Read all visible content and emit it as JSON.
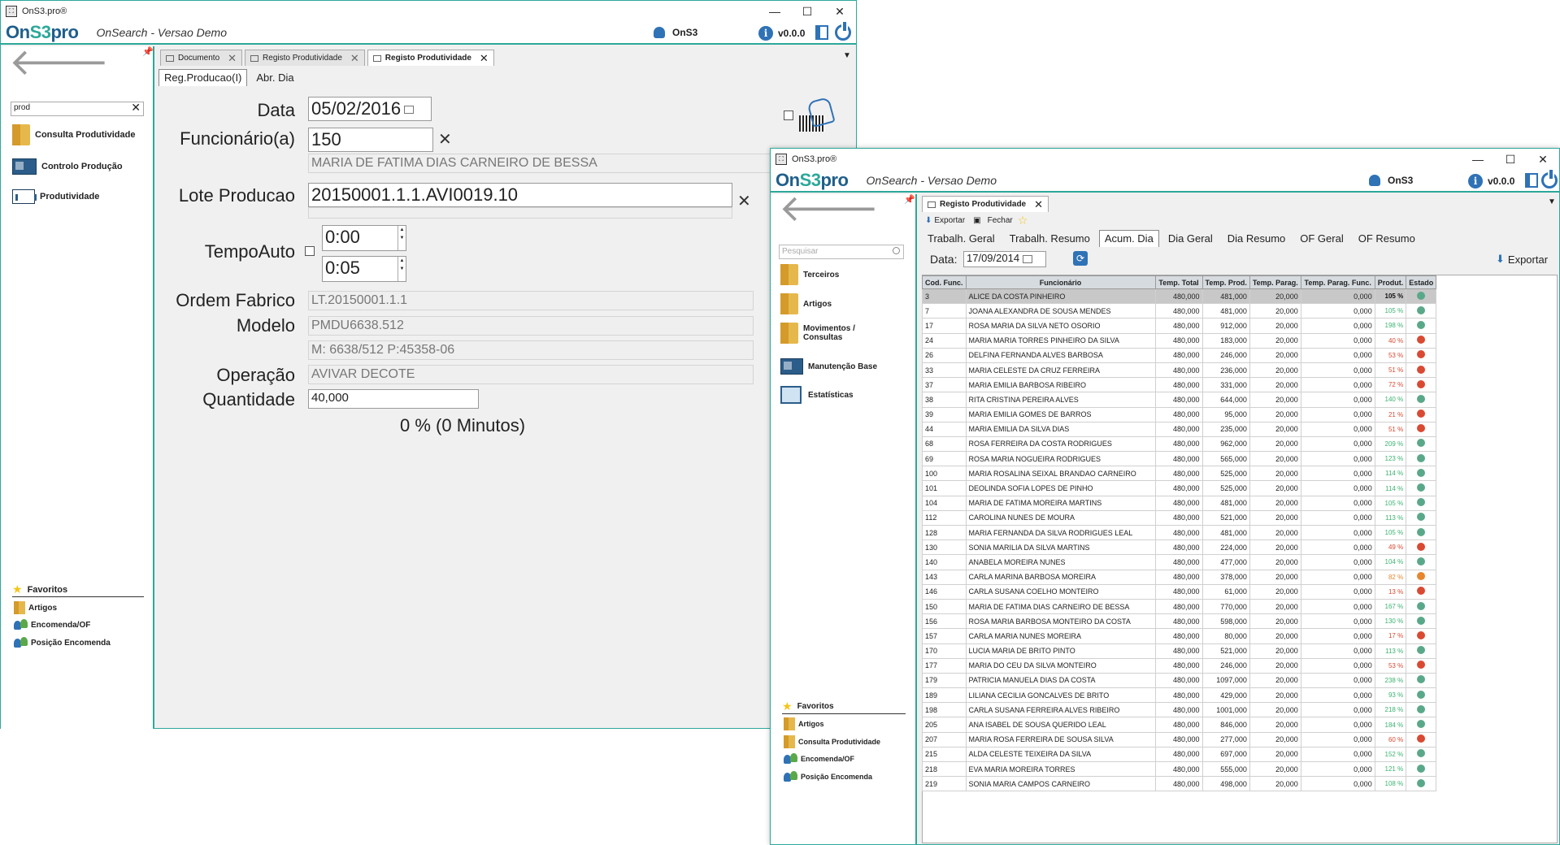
{
  "w1": {
    "title": "OnS3.pro®",
    "subtitle": "OnSearch - Versao Demo",
    "user": "OnS3",
    "version": "v0.0.0",
    "search_value": "prod",
    "nav": [
      "Consulta Produtividade",
      "Controlo Produção",
      "Produtividade"
    ],
    "fav_title": "Favoritos",
    "favs": [
      "Artigos",
      "Encomenda/OF",
      "Posição Encomenda"
    ],
    "tabs": [
      "Documento",
      "Registo Produtividade",
      "Registo Produtividade"
    ],
    "subtabs": [
      "Reg.Producao(I)",
      "Abr. Dia"
    ],
    "form": {
      "data_label": "Data",
      "data_value": "05/02/2016",
      "func_label": "Funcionário(a)",
      "func_value": "150",
      "func_name": "MARIA DE FATIMA DIAS CARNEIRO DE BESSA",
      "lote_label": "Lote Producao",
      "lote_value": "20150001.1.1.AVI0019.10",
      "tempo_label": "TempoAuto",
      "tempo1": "0:00",
      "tempo2": "0:05",
      "ordem_label": "Ordem Fabrico",
      "ordem_value": "LT.20150001.1.1",
      "modelo_label": "Modelo",
      "modelo_value": "PMDU6638.512",
      "modelo_detail": "M: 6638/512 P:45358-06",
      "operacao_label": "Operação",
      "operacao_value": "AVIVAR DECOTE",
      "qtd_label": "Quantidade",
      "qtd_value": "40,000",
      "percent": "0 % (0 Minutos)"
    }
  },
  "w2": {
    "title": "OnS3.pro®",
    "subtitle": "OnSearch - Versao Demo",
    "user": "OnS3",
    "version": "v0.0.0",
    "search_placeholder": "Pesquisar",
    "nav": [
      "Terceiros",
      "Artigos",
      "Movimentos / Consultas",
      "Manutenção Base",
      "Estatísticas"
    ],
    "fav_title": "Favoritos",
    "favs": [
      "Artigos",
      "Consulta Produtividade",
      "Encomenda/OF",
      "Posição Encomenda"
    ],
    "tab": "Registo Produtividade",
    "toolbar": {
      "export": "Exportar",
      "close": "Fechar"
    },
    "subtabs": [
      "Trabalh. Geral",
      "Trabalh. Resumo",
      "Acum. Dia",
      "Dia Geral",
      "Dia Resumo",
      "OF Geral",
      "OF Resumo"
    ],
    "date_label": "Data:",
    "date_value": "17/09/2014",
    "export_label": "Exportar",
    "columns": [
      "Cod. Func.",
      "Funcionário",
      "Temp. Total",
      "Temp. Prod.",
      "Temp. Parag.",
      "Temp. Parag. Func.",
      "Produt.",
      "Estado"
    ],
    "rows": [
      [
        "3",
        "ALICE DA COSTA PINHEIRO",
        "480,000",
        "481,000",
        "20,000",
        "0,000",
        "105 %",
        "green"
      ],
      [
        "7",
        "JOANA ALEXANDRA DE SOUSA MENDES",
        "480,000",
        "481,000",
        "20,000",
        "0,000",
        "105 %",
        "green"
      ],
      [
        "17",
        "ROSA MARIA DA SILVA NETO OSORIO",
        "480,000",
        "912,000",
        "20,000",
        "0,000",
        "198 %",
        "green"
      ],
      [
        "24",
        "MARIA MARIA TORRES PINHEIRO DA SILVA",
        "480,000",
        "183,000",
        "20,000",
        "0,000",
        "40 %",
        "red"
      ],
      [
        "26",
        "DELFINA FERNANDA ALVES BARBOSA",
        "480,000",
        "246,000",
        "20,000",
        "0,000",
        "53 %",
        "red"
      ],
      [
        "33",
        "MARIA CELESTE DA CRUZ FERREIRA",
        "480,000",
        "236,000",
        "20,000",
        "0,000",
        "51 %",
        "red"
      ],
      [
        "37",
        "MARIA EMILIA BARBOSA RIBEIRO",
        "480,000",
        "331,000",
        "20,000",
        "0,000",
        "72 %",
        "red"
      ],
      [
        "38",
        "RITA CRISTINA PEREIRA ALVES",
        "480,000",
        "644,000",
        "20,000",
        "0,000",
        "140 %",
        "green"
      ],
      [
        "39",
        "MARIA EMILIA GOMES DE BARROS",
        "480,000",
        "95,000",
        "20,000",
        "0,000",
        "21 %",
        "red"
      ],
      [
        "44",
        "MARIA EMILIA DA SILVA DIAS",
        "480,000",
        "235,000",
        "20,000",
        "0,000",
        "51 %",
        "red"
      ],
      [
        "68",
        "ROSA FERREIRA DA COSTA RODRIGUES",
        "480,000",
        "962,000",
        "20,000",
        "0,000",
        "209 %",
        "green"
      ],
      [
        "69",
        "ROSA MARIA NOGUEIRA RODRIGUES",
        "480,000",
        "565,000",
        "20,000",
        "0,000",
        "123 %",
        "green"
      ],
      [
        "100",
        "MARIA ROSALINA SEIXAL BRANDAO CARNEIRO",
        "480,000",
        "525,000",
        "20,000",
        "0,000",
        "114 %",
        "green"
      ],
      [
        "101",
        "DEOLINDA SOFIA LOPES DE PINHO",
        "480,000",
        "525,000",
        "20,000",
        "0,000",
        "114 %",
        "green"
      ],
      [
        "104",
        "MARIA DE FATIMA MOREIRA MARTINS",
        "480,000",
        "481,000",
        "20,000",
        "0,000",
        "105 %",
        "green"
      ],
      [
        "112",
        "CAROLINA NUNES DE MOURA",
        "480,000",
        "521,000",
        "20,000",
        "0,000",
        "113 %",
        "green"
      ],
      [
        "128",
        "MARIA FERNANDA DA SILVA RODRIGUES LEAL",
        "480,000",
        "481,000",
        "20,000",
        "0,000",
        "105 %",
        "green"
      ],
      [
        "130",
        "SONIA MARILIA DA SILVA MARTINS",
        "480,000",
        "224,000",
        "20,000",
        "0,000",
        "49 %",
        "red"
      ],
      [
        "140",
        "ANABELA MOREIRA NUNES",
        "480,000",
        "477,000",
        "20,000",
        "0,000",
        "104 %",
        "green"
      ],
      [
        "143",
        "CARLA MARINA BARBOSA MOREIRA",
        "480,000",
        "378,000",
        "20,000",
        "0,000",
        "82 %",
        "orange"
      ],
      [
        "146",
        "CARLA SUSANA COELHO MONTEIRO",
        "480,000",
        "61,000",
        "20,000",
        "0,000",
        "13 %",
        "red"
      ],
      [
        "150",
        "MARIA DE FATIMA DIAS CARNEIRO DE BESSA",
        "480,000",
        "770,000",
        "20,000",
        "0,000",
        "167 %",
        "green"
      ],
      [
        "156",
        "ROSA MARIA BARBOSA MONTEIRO DA COSTA",
        "480,000",
        "598,000",
        "20,000",
        "0,000",
        "130 %",
        "green"
      ],
      [
        "157",
        "CARLA MARIA NUNES MOREIRA",
        "480,000",
        "80,000",
        "20,000",
        "0,000",
        "17 %",
        "red"
      ],
      [
        "170",
        "LUCIA MARIA DE BRITO PINTO",
        "480,000",
        "521,000",
        "20,000",
        "0,000",
        "113 %",
        "green"
      ],
      [
        "177",
        "MARIA DO CEU DA SILVA MONTEIRO",
        "480,000",
        "246,000",
        "20,000",
        "0,000",
        "53 %",
        "red"
      ],
      [
        "179",
        "PATRICIA MANUELA DIAS DA COSTA",
        "480,000",
        "1097,000",
        "20,000",
        "0,000",
        "238 %",
        "green"
      ],
      [
        "189",
        "LILIANA CECILIA GONCALVES DE BRITO",
        "480,000",
        "429,000",
        "20,000",
        "0,000",
        "93 %",
        "green"
      ],
      [
        "198",
        "CARLA SUSANA FERREIRA ALVES RIBEIRO",
        "480,000",
        "1001,000",
        "20,000",
        "0,000",
        "218 %",
        "green"
      ],
      [
        "205",
        "ANA ISABEL DE SOUSA QUERIDO LEAL",
        "480,000",
        "846,000",
        "20,000",
        "0,000",
        "184 %",
        "green"
      ],
      [
        "207",
        "MARIA ROSA FERREIRA DE SOUSA SILVA",
        "480,000",
        "277,000",
        "20,000",
        "0,000",
        "60 %",
        "red"
      ],
      [
        "215",
        "ALDA CELESTE TEIXEIRA DA SILVA",
        "480,000",
        "697,000",
        "20,000",
        "0,000",
        "152 %",
        "green"
      ],
      [
        "218",
        "EVA MARIA MOREIRA TORRES",
        "480,000",
        "555,000",
        "20,000",
        "0,000",
        "121 %",
        "green"
      ],
      [
        "219",
        "SONIA MARIA CAMPOS CARNEIRO",
        "480,000",
        "498,000",
        "20,000",
        "0,000",
        "108 %",
        "green"
      ]
    ]
  },
  "colors": {
    "accent": "#2ca89a",
    "brand": "#1f5f8b",
    "icon_blue": "#2f72b6",
    "good": "#5aa88a",
    "bad": "#d94a32",
    "warn": "#e8862e",
    "pct_good": "#3cb371",
    "pct_bad": "#d94a32",
    "pct_warn": "#e8862e"
  },
  "icons": [
    "back-arrow-icon",
    "pin-icon",
    "user-icon",
    "info-icon",
    "exit-icon",
    "power-icon",
    "star-icon",
    "folder-icon",
    "barcode-icon",
    "scanner-icon",
    "calendar-icon",
    "refresh-icon",
    "export-icon"
  ]
}
